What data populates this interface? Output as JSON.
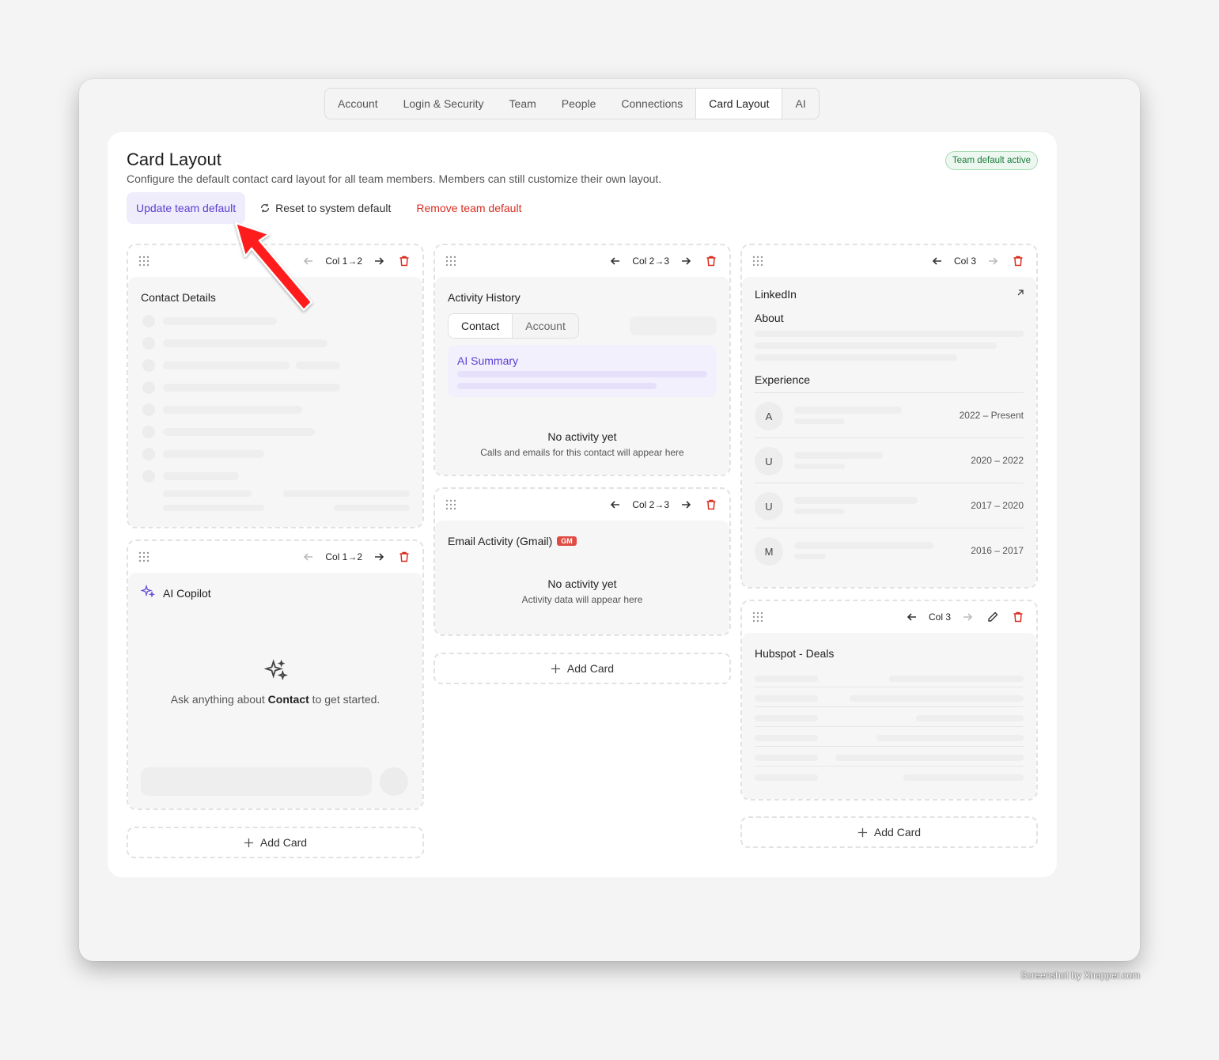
{
  "tabs": [
    "Account",
    "Login & Security",
    "Team",
    "People",
    "Connections",
    "Card Layout",
    "AI"
  ],
  "active_tab": "Card Layout",
  "header": {
    "title": "Card Layout",
    "subtitle": "Configure the default contact card layout for all team members. Members can still customize their own layout.",
    "status_badge": "Team default active"
  },
  "actions": {
    "update": "Update team default",
    "reset": "Reset to system default",
    "remove": "Remove team default"
  },
  "cards": {
    "contact_details": {
      "col": "Col 1→2",
      "title": "Contact Details"
    },
    "ai_copilot": {
      "col": "Col 1→2",
      "title": "AI Copilot",
      "prompt_pre": "Ask anything about ",
      "prompt_bold": "Contact",
      "prompt_post": " to get started."
    },
    "activity_history": {
      "col": "Col 2→3",
      "title": "Activity History",
      "tabs": [
        "Contact",
        "Account"
      ],
      "ai_summary": "AI Summary",
      "empty_title": "No activity yet",
      "empty_sub": "Calls and emails for this contact will appear here"
    },
    "email_activity": {
      "col": "Col 2→3",
      "title": "Email Activity (Gmail)",
      "badge": "GM",
      "empty_title": "No activity yet",
      "empty_sub": "Activity data will appear here"
    },
    "linkedin": {
      "col": "Col 3",
      "title": "LinkedIn",
      "about": "About",
      "experience": "Experience",
      "jobs": [
        {
          "initial": "A",
          "dates": "2022 – Present"
        },
        {
          "initial": "U",
          "dates": "2020 – 2022"
        },
        {
          "initial": "U",
          "dates": "2017 – 2020"
        },
        {
          "initial": "M",
          "dates": "2016 – 2017"
        }
      ]
    },
    "hubspot": {
      "col": "Col 3",
      "title": "Hubspot - Deals"
    }
  },
  "add_card": "Add Card",
  "watermark": "Screenshot by Xnapper.com",
  "colors": {
    "accent": "#5b3fd1",
    "danger": "#d92d20",
    "success": "#1f7a3e"
  }
}
